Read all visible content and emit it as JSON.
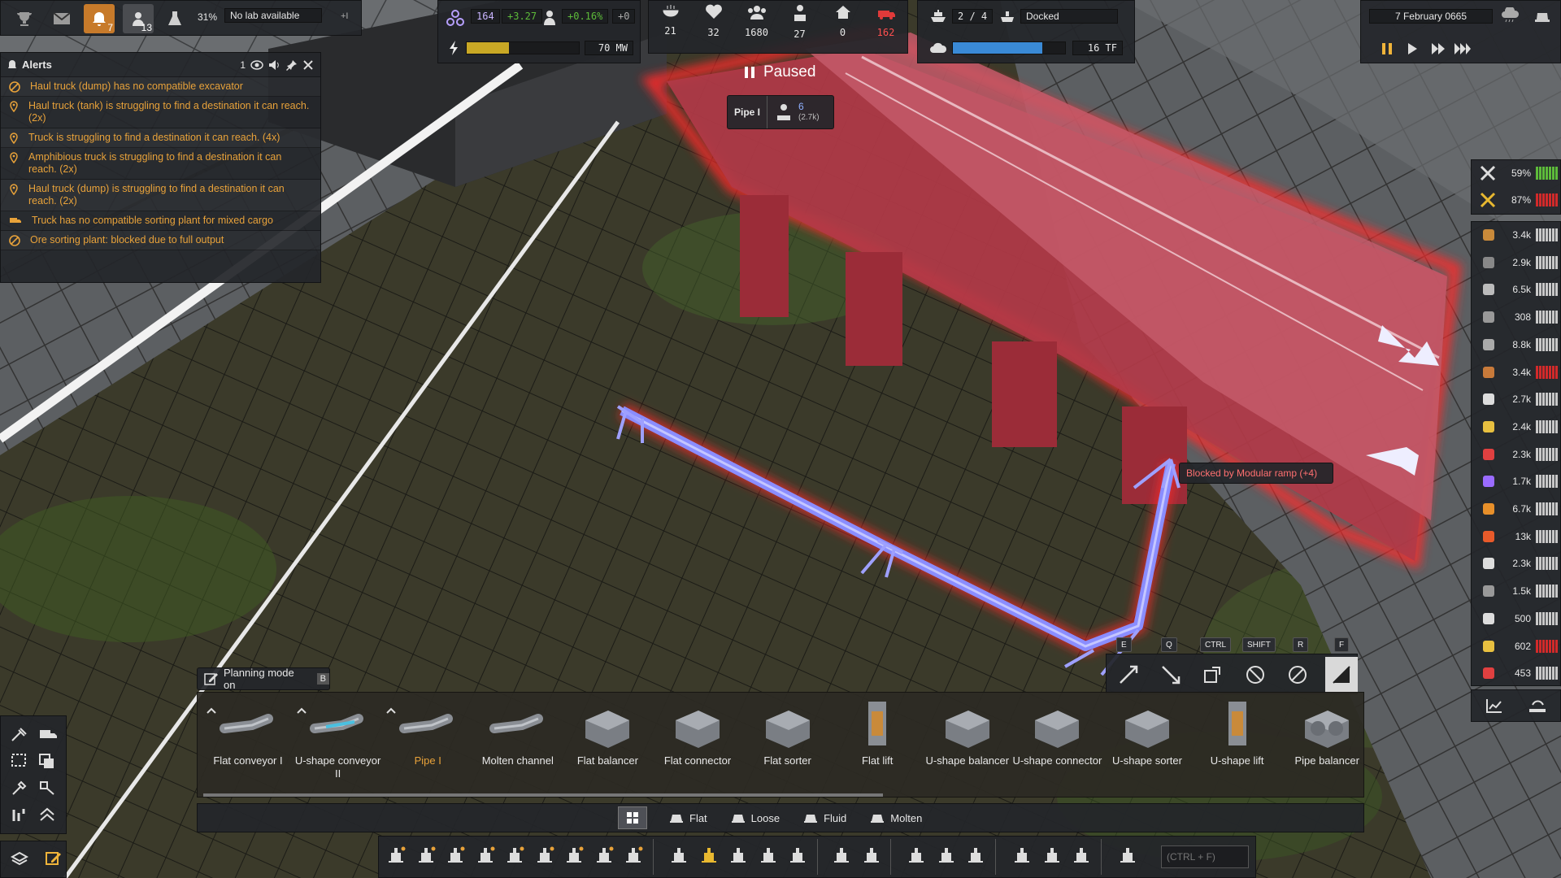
{
  "top_left": {
    "research_pct": "31%",
    "lab_status": "No lab available",
    "plus": "+I",
    "alerts_badge": "7",
    "workers_badge": "13"
  },
  "alerts": {
    "title": "Alerts",
    "count": "1",
    "items": [
      "Haul truck (dump) has no compatible excavator",
      "Haul truck (tank) is struggling to find a destination it can reach. (2x)",
      "Truck is struggling to find a destination it can reach. (4x)",
      "Amphibious truck is struggling to find a destination it can reach. (2x)",
      "Haul truck (dump) is struggling to find a destination it can reach. (2x)",
      "Truck has no compatible sorting plant for mixed cargo",
      "Ore sorting plant: blocked due to full output"
    ]
  },
  "unity": {
    "value": "164",
    "delta": "+3.27"
  },
  "pop_growth": {
    "pct": "+0.16%",
    "delta": "+0"
  },
  "power": {
    "value": "70 MW",
    "fill": 0.38
  },
  "stats": [
    "21",
    "32",
    "1680",
    "27",
    "0",
    "162"
  ],
  "ships": {
    "count": "2 / 4",
    "status": "Docked"
  },
  "compute": {
    "value": "16 TF",
    "fill": 0.8
  },
  "date": "7 February 0665",
  "paused": "Paused",
  "tooltip": {
    "name": "Pipe I",
    "count": "6",
    "sub": "(2.7k)"
  },
  "blocked": "Blocked by Modular ramp (+4)",
  "maintenance": [
    {
      "pct": "59%",
      "color": "#5dbb3a"
    },
    {
      "pct": "87%",
      "color": "#d22a2a"
    }
  ],
  "resources": [
    {
      "icon": "barrel-icon",
      "value": "3.4k",
      "color": "#c8c8c8"
    },
    {
      "icon": "rock-icon",
      "value": "2.9k",
      "color": "#c8c8c8"
    },
    {
      "icon": "cube-icon",
      "value": "6.5k",
      "color": "#c8c8c8"
    },
    {
      "icon": "plate-icon",
      "value": "308",
      "color": "#c8c8c8"
    },
    {
      "icon": "slab-icon",
      "value": "8.8k",
      "color": "#c8c8c8"
    },
    {
      "icon": "wood-icon",
      "value": "3.4k",
      "color": "#d22a2a"
    },
    {
      "icon": "worker-icon",
      "value": "2.7k",
      "color": "#c8c8c8"
    },
    {
      "icon": "worker-gold-icon",
      "value": "2.4k",
      "color": "#c8c8c8"
    },
    {
      "icon": "worker-red-icon",
      "value": "2.3k",
      "color": "#c8c8c8"
    },
    {
      "icon": "worker-purple-icon",
      "value": "1.7k",
      "color": "#c8c8c8"
    },
    {
      "icon": "flask-orange-icon",
      "value": "6.7k",
      "color": "#c8c8c8"
    },
    {
      "icon": "fire-icon",
      "value": "13k",
      "color": "#c8c8c8"
    },
    {
      "icon": "canister-icon",
      "value": "2.3k",
      "color": "#c8c8c8"
    },
    {
      "icon": "ingot-icon",
      "value": "1.5k",
      "color": "#c8c8c8"
    },
    {
      "icon": "wrench-icon",
      "value": "500",
      "color": "#c8c8c8"
    },
    {
      "icon": "wrench-gold-icon",
      "value": "602",
      "color": "#d22a2a"
    },
    {
      "icon": "wrench-red-icon",
      "value": "453",
      "color": "#c8c8c8"
    }
  ],
  "planning": {
    "label": "Planning mode on",
    "key": "B"
  },
  "keys": [
    "E",
    "Q",
    "CTRL",
    "SHIFT",
    "R",
    "F"
  ],
  "palette": [
    {
      "label": "Flat conveyor I",
      "active": false
    },
    {
      "label": "U-shape conveyor II",
      "active": false
    },
    {
      "label": "Pipe I",
      "active": true
    },
    {
      "label": "Molten channel",
      "active": false
    },
    {
      "label": "Flat balancer",
      "active": false
    },
    {
      "label": "Flat connector",
      "active": false
    },
    {
      "label": "Flat sorter",
      "active": false
    },
    {
      "label": "Flat lift",
      "active": false
    },
    {
      "label": "U-shape balancer",
      "active": false
    },
    {
      "label": "U-shape connector",
      "active": false
    },
    {
      "label": "U-shape sorter",
      "active": false
    },
    {
      "label": "U-shape lift",
      "active": false
    },
    {
      "label": "Pipe balancer",
      "active": false
    }
  ],
  "tabs": [
    "Flat",
    "Loose",
    "Fluid",
    "Molten"
  ],
  "search": {
    "placeholder": "(CTRL + F)"
  },
  "colors": {
    "accent": "#e8a23a",
    "danger": "#d22a2a",
    "pipe": "#8a8dff"
  }
}
